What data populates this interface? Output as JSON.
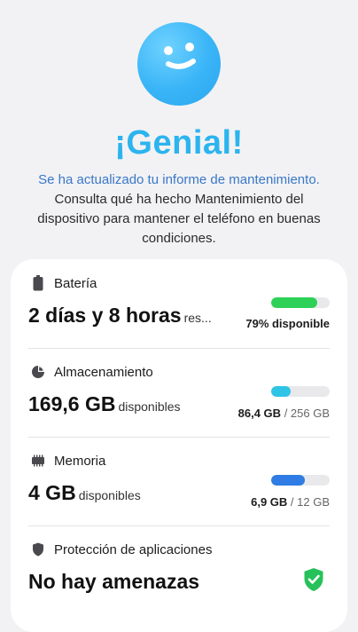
{
  "header": {
    "headline": "¡Genial!",
    "highlight": "Se ha actualizado tu informe de mantenimiento.",
    "description": "Consulta qué ha hecho Mantenimiento del dispositivo para mantener el teléfono en buenas condiciones."
  },
  "battery": {
    "title": "Batería",
    "value": "2 días y 8 horas",
    "suffix": "res...",
    "level": 0.79,
    "color": "#2ed158",
    "meta": "79% disponible"
  },
  "storage": {
    "title": "Almacenamiento",
    "value": "169,6 GB",
    "suffix": "disponibles",
    "level": 0.34,
    "color": "#2ec4e6",
    "used": "86,4 GB",
    "total": "/ 256 GB"
  },
  "memory": {
    "title": "Memoria",
    "value": "4 GB",
    "suffix": "disponibles",
    "level": 0.58,
    "color": "#2f7ce4",
    "used": "6,9 GB",
    "total": "/ 12 GB"
  },
  "protection": {
    "title": "Protección de aplicaciones",
    "value": "No hay amenazas",
    "status_color": "#27c15b"
  },
  "icons": {
    "face": "smiley-face-icon",
    "battery": "battery-icon",
    "storage": "pie-chart-icon",
    "memory": "memory-chip-icon",
    "protection": "shield-icon",
    "status": "shield-check-icon"
  }
}
